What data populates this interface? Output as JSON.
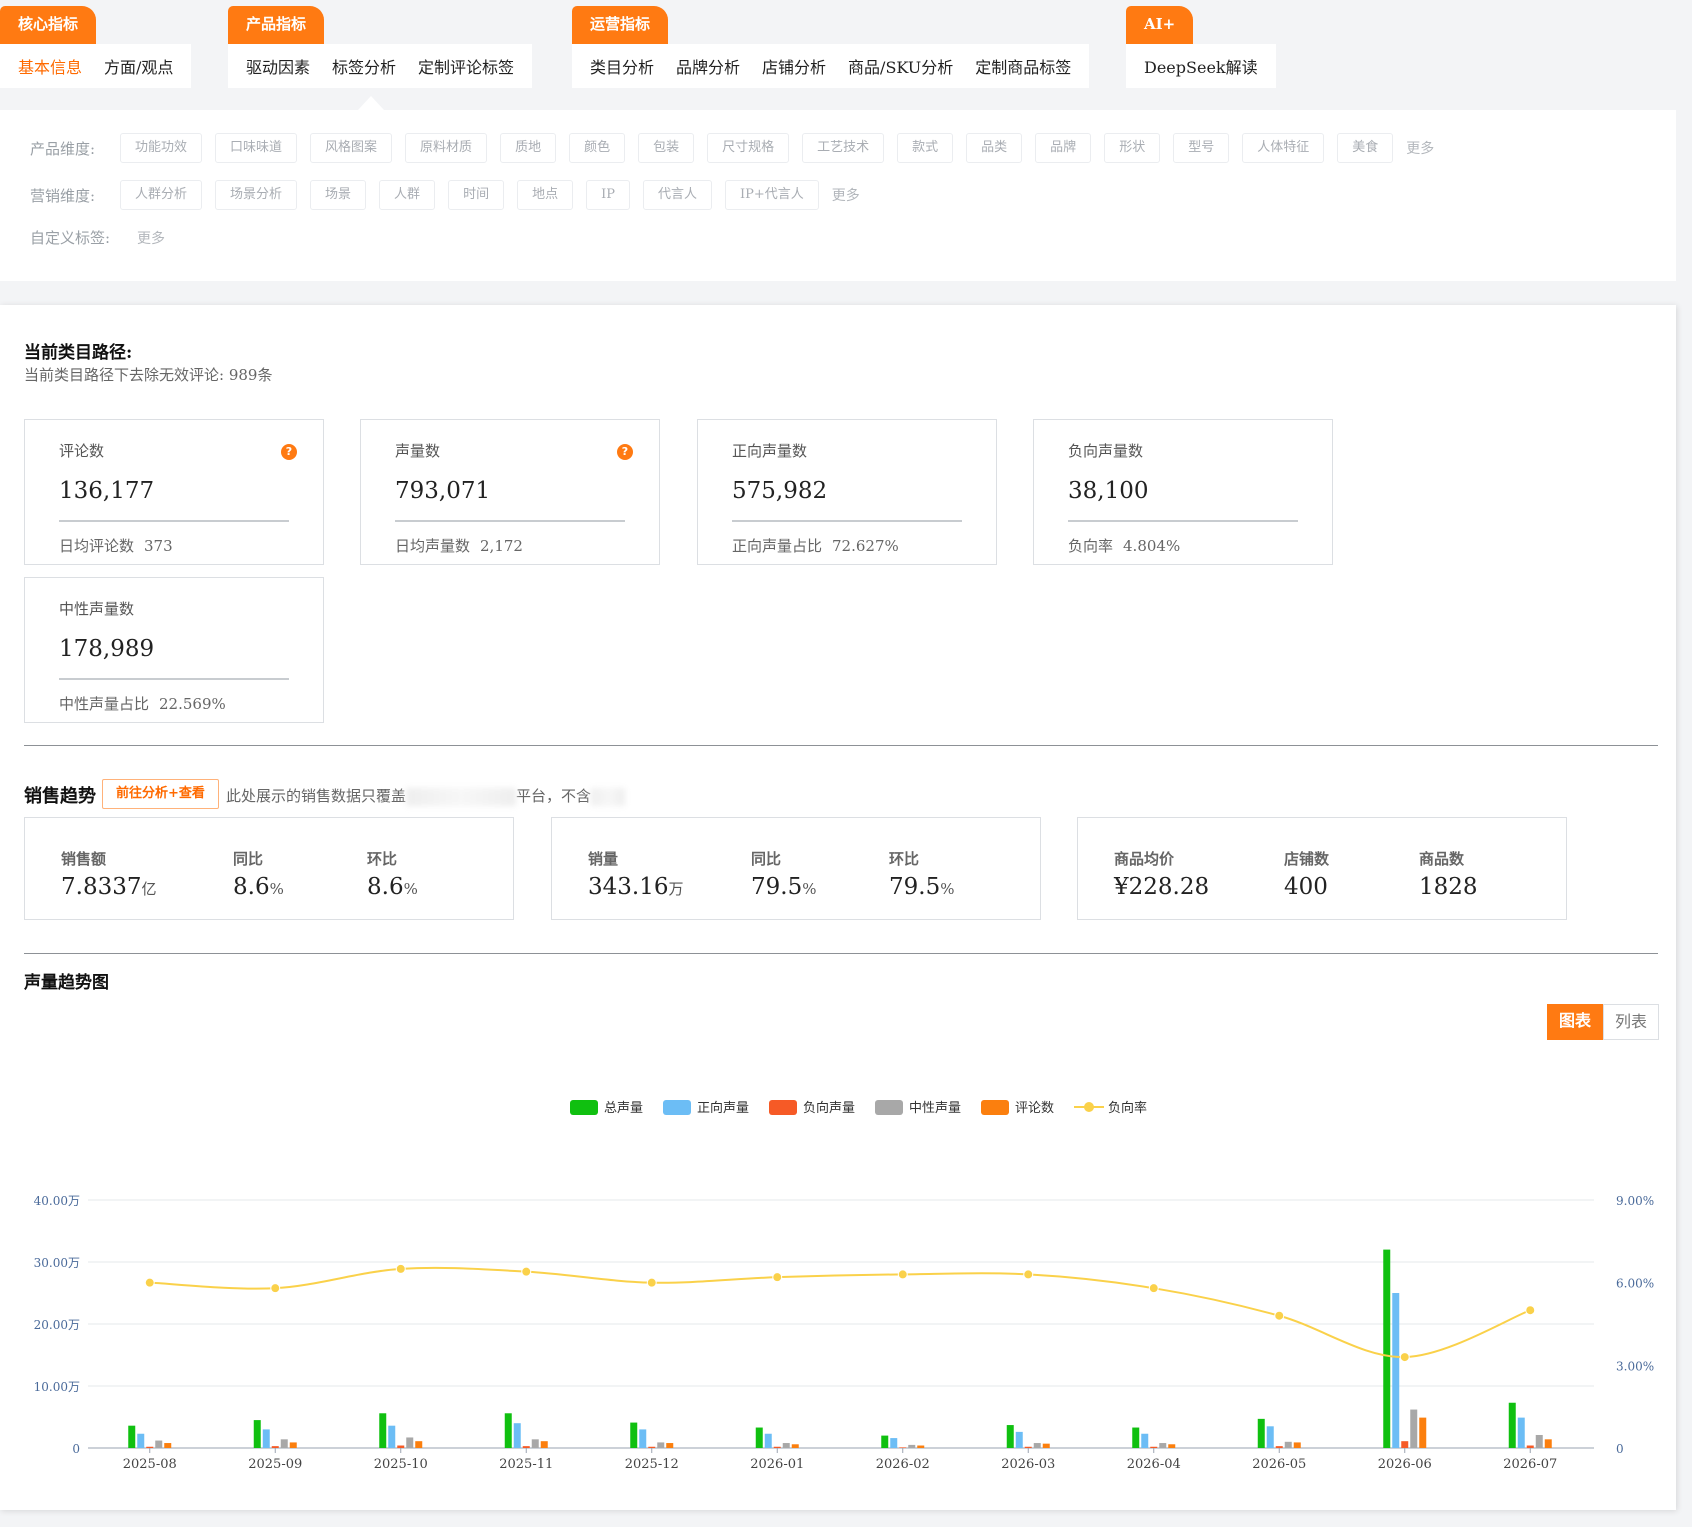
{
  "tab_groups": [
    {
      "label": "核心指标",
      "left": 0,
      "items": [
        {
          "label": "基本信息",
          "active": true
        },
        {
          "label": "方面/观点",
          "active": false
        }
      ]
    },
    {
      "label": "产品指标",
      "left": 228,
      "items": [
        {
          "label": "驱动因素",
          "active": false
        },
        {
          "label": "标签分析",
          "active": false
        },
        {
          "label": "定制评论标签",
          "active": false
        }
      ]
    },
    {
      "label": "运营指标",
      "left": 572,
      "items": [
        {
          "label": "类目分析",
          "active": false
        },
        {
          "label": "品牌分析",
          "active": false
        },
        {
          "label": "店铺分析",
          "active": false
        },
        {
          "label": "商品/SKU分析",
          "active": false
        },
        {
          "label": "定制商品标签",
          "active": false
        }
      ]
    },
    {
      "label": "AI+",
      "left": 1126,
      "items": [
        {
          "label": "DeepSeek解读",
          "active": false
        }
      ]
    }
  ],
  "filters": {
    "product": {
      "label": "产品维度:",
      "chips": [
        "功能功效",
        "口味味道",
        "风格图案",
        "原料材质",
        "质地",
        "颜色",
        "包装",
        "尺寸规格",
        "工艺技术",
        "款式",
        "品类",
        "品牌",
        "形状",
        "型号",
        "人体特征",
        "美食"
      ],
      "more": "更多"
    },
    "marketing": {
      "label": "营销维度:",
      "chips": [
        "人群分析",
        "场景分析",
        "场景",
        "人群",
        "时间",
        "地点",
        "IP",
        "代言人",
        "IP+代言人"
      ],
      "more": "更多"
    },
    "custom": {
      "label": "自定义标签:",
      "chips": [],
      "more": "更多"
    }
  },
  "path": {
    "title": "当前类目路径:",
    "subtitle": "当前类目路径下去除无效评论: 989条"
  },
  "stats": [
    {
      "label": "评论数",
      "value": "136,177",
      "foot_label": "日均评论数",
      "foot_value": "373",
      "help": true
    },
    {
      "label": "声量数",
      "value": "793,071",
      "foot_label": "日均声量数",
      "foot_value": "2,172",
      "help": true
    },
    {
      "label": "正向声量数",
      "value": "575,982",
      "foot_label": "正向声量占比",
      "foot_value": "72.627%",
      "help": false
    },
    {
      "label": "负向声量数",
      "value": "38,100",
      "foot_label": "负向率",
      "foot_value": "4.804%",
      "help": false
    },
    {
      "label": "中性声量数",
      "value": "178,989",
      "foot_label": "中性声量占比",
      "foot_value": "22.569%",
      "help": false
    }
  ],
  "sales": {
    "title": "销售趋势",
    "button": "前往分析+查看",
    "note_a": "此处展示的销售数据只覆盖",
    "note_b": "平台，不含",
    "groups": [
      [
        {
          "label": "销售额",
          "value": "7.8337",
          "unit": "亿"
        },
        {
          "label": "同比",
          "value": "8.6",
          "unit": "%"
        },
        {
          "label": "环比",
          "value": "8.6",
          "unit": "%"
        }
      ],
      [
        {
          "label": "销量",
          "value": "343.16",
          "unit": "万"
        },
        {
          "label": "同比",
          "value": "79.5",
          "unit": "%"
        },
        {
          "label": "环比",
          "value": "79.5",
          "unit": "%"
        }
      ],
      [
        {
          "label": "商品均价",
          "value": "¥228.28",
          "unit": ""
        },
        {
          "label": "店铺数",
          "value": "400",
          "unit": ""
        },
        {
          "label": "商品数",
          "value": "1828",
          "unit": ""
        }
      ]
    ]
  },
  "trend": {
    "title": "声量趋势图",
    "view_chart": "图表",
    "view_list": "列表"
  },
  "chart_data": {
    "type": "bar",
    "categories": [
      "2025-08",
      "2025-09",
      "2025-10",
      "2025-11",
      "2025-12",
      "2026-01",
      "2026-02",
      "2026-03",
      "2026-04",
      "2026-05",
      "2026-06",
      "2026-07"
    ],
    "series": [
      {
        "name": "总声量",
        "type": "bar",
        "axis": "left",
        "color": "#10c010",
        "values": [
          3.6,
          4.5,
          5.6,
          5.6,
          4.1,
          3.3,
          2.0,
          3.7,
          3.3,
          4.7,
          32.0,
          7.3
        ]
      },
      {
        "name": "正向声量",
        "type": "bar",
        "axis": "left",
        "color": "#6cbdf5",
        "values": [
          2.3,
          3.0,
          3.6,
          4.0,
          3.0,
          2.3,
          1.6,
          2.6,
          2.3,
          3.5,
          25.0,
          4.9
        ]
      },
      {
        "name": "负向声量",
        "type": "bar",
        "axis": "left",
        "color": "#f65a26",
        "values": [
          0.2,
          0.3,
          0.4,
          0.3,
          0.2,
          0.2,
          0.1,
          0.2,
          0.2,
          0.3,
          1.1,
          0.4
        ]
      },
      {
        "name": "中性声量",
        "type": "bar",
        "axis": "left",
        "color": "#a8a8a8",
        "values": [
          1.2,
          1.4,
          1.7,
          1.4,
          0.9,
          0.8,
          0.5,
          0.8,
          0.8,
          1.0,
          6.2,
          2.1
        ]
      },
      {
        "name": "评论数",
        "type": "bar",
        "axis": "left",
        "color": "#fb7f0e",
        "values": [
          0.8,
          0.9,
          1.1,
          1.1,
          0.8,
          0.6,
          0.4,
          0.7,
          0.6,
          0.9,
          4.9,
          1.4
        ]
      },
      {
        "name": "负向率",
        "type": "line",
        "axis": "right",
        "color": "#fad14a",
        "values": [
          6.0,
          5.8,
          6.5,
          6.4,
          6.0,
          6.2,
          6.3,
          6.3,
          5.8,
          4.8,
          3.3,
          5.0
        ]
      }
    ],
    "y_left": {
      "min": 0,
      "max": 40,
      "ticks": [
        "0",
        "10.00万",
        "20.00万",
        "30.00万",
        "40.00万"
      ]
    },
    "y_right": {
      "min": 0,
      "max": 9,
      "ticks": [
        "0",
        "3.00%",
        "6.00%",
        "9.00%"
      ]
    },
    "legend_position": "top-center",
    "grid": true
  }
}
